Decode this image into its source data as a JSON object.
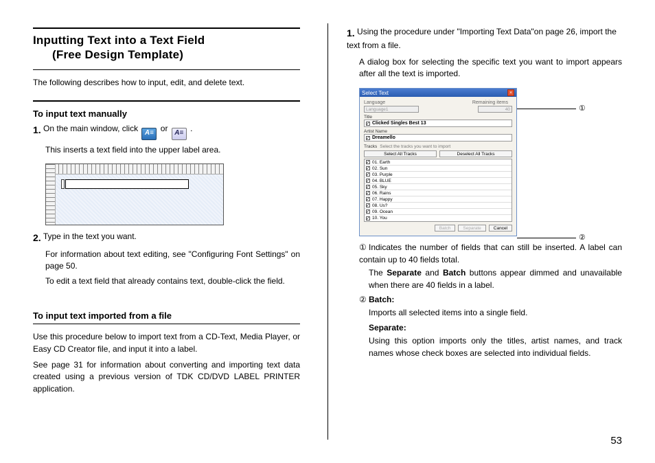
{
  "left": {
    "title_line1": "Inputting Text into a Text Field",
    "title_line2": "(Free Design Template)",
    "intro": "The following describes how to input, edit, and delete text.",
    "sub1": "To input text manually",
    "step1_num": "1.",
    "step1_a": "On the main window, click ",
    "step1_b": " or ",
    "step1_c": ".",
    "step1_sub": "This inserts a text field into the upper label area.",
    "step2_num": "2.",
    "step2_text": "Type in the text you want.",
    "step2_sub1": "For information about text editing, see \"Configuring Font Settings\" on page 50.",
    "step2_sub2": "To edit a text field that already contains text, double-click the field.",
    "sub2": "To input text imported from a file",
    "para1": "Use this procedure below to import text from a CD-Text, Media Player, or Easy CD Creator file, and input it into a label.",
    "para2": "See page 31 for information about converting and importing text data created using a previous version of TDK CD/DVD LABEL PRINTER application."
  },
  "right": {
    "step1_num": "1.",
    "step1_text": "Using the procedure under \"Importing Text Data\"on page 26, import the text from a file.",
    "step1_sub": "A dialog box for selecting the specific text you want to import appears after all the text is imported.",
    "callout1_num": "①",
    "callout1_text": "Indicates the number of fields that can still be inserted. A label can contain up to 40 fields total.",
    "callout1_sub": "The Separate and Batch buttons appear dimmed and unavailable when there are 40 fields in a label.",
    "callout1_sub_bold1": "Separate",
    "callout1_sub_bold2": "Batch",
    "callout2_num": "②",
    "batch_label": "Batch:",
    "batch_text": "Imports all selected items into a single field.",
    "sep_label": "Separate:",
    "sep_text": "Using this option imports only the titles, artist names, and track names whose check boxes are selected into individual fields.",
    "pointer1": "①",
    "pointer2": "②"
  },
  "dialog": {
    "title": "Select Text",
    "lang_lbl": "Language",
    "lang_val": "Language1",
    "remain_lbl": "Remaining items",
    "remain_val": "40",
    "title_lbl": "Title",
    "title_val": "Clicked Singles Best 13",
    "artist_lbl": "Artist Name",
    "artist_val": "Dreamello",
    "tracks_lbl": "Tracks",
    "tracks_desc": "Select the tracks you want to import",
    "selall": "Select All Tracks",
    "deselall": "Deselect All Tracks",
    "tracks": [
      "01. Earth",
      "02. Sun",
      "03. Purple",
      "04. BLUE",
      "05. Sky",
      "06. Rains",
      "07. Happy",
      "08. Us?",
      "09. Ocean",
      "10. You"
    ],
    "btn_batch": "Batch",
    "btn_sep": "Separate",
    "btn_cancel": "Cancel"
  },
  "page_number": "53"
}
